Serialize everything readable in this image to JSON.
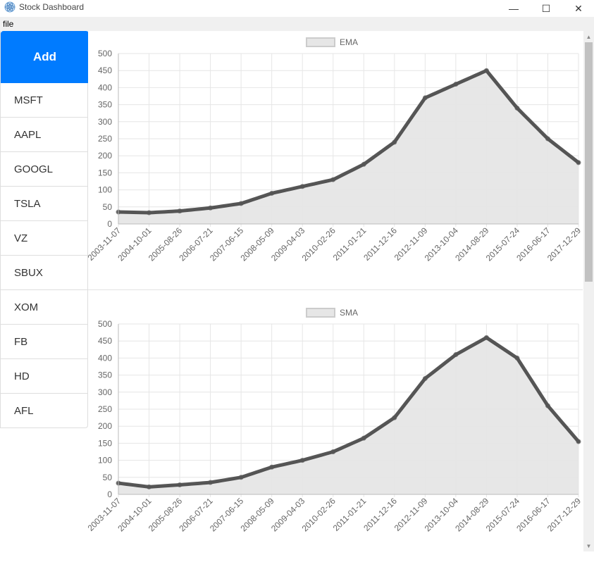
{
  "window": {
    "title": "Stock Dashboard",
    "minimize_glyph": "—",
    "maximize_glyph": "☐",
    "close_glyph": "✕"
  },
  "menu": {
    "file_label": "file"
  },
  "sidebar": {
    "add_label": "Add",
    "add_color": "#007bff",
    "tickers": [
      "MSFT",
      "AAPL",
      "GOOGL",
      "TSLA",
      "VZ",
      "SBUX",
      "XOM",
      "FB",
      "HD",
      "AFL"
    ]
  },
  "scrollbar": {
    "up_glyph": "▲",
    "down_glyph": "▼"
  },
  "chart_data": [
    {
      "type": "area",
      "legend": "EMA",
      "legend_position": "top",
      "grid": true,
      "ylim": [
        0,
        500
      ],
      "yticks": [
        0,
        50,
        100,
        150,
        200,
        250,
        300,
        350,
        400,
        450,
        500
      ],
      "x_tick_labels": [
        "2003-11-07",
        "2004-10-01",
        "2005-08-26",
        "2006-07-21",
        "2007-06-15",
        "2008-05-09",
        "2009-04-03",
        "2010-02-26",
        "2011-01-21",
        "2011-12-16",
        "2012-11-09",
        "2013-10-04",
        "2014-08-29",
        "2015-07-24",
        "2016-06-17",
        "2017-12-29"
      ],
      "x": [
        "2003-11-07",
        "2004-10-01",
        "2005-08-26",
        "2006-07-21",
        "2007-06-15",
        "2008-05-09",
        "2009-04-03",
        "2010-02-26",
        "2011-01-21",
        "2011-12-16",
        "2012-11-09",
        "2013-10-04",
        "2014-08-29",
        "2015-07-24",
        "2016-06-17",
        "2017-12-29"
      ],
      "values": [
        35,
        33,
        38,
        47,
        60,
        90,
        110,
        130,
        175,
        240,
        370,
        410,
        450,
        340,
        250,
        180
      ],
      "line_color": "#444444",
      "fill_color": "#e6e6e6"
    },
    {
      "type": "area",
      "legend": "SMA",
      "legend_position": "top",
      "grid": true,
      "ylim": [
        0,
        500
      ],
      "yticks": [
        0,
        50,
        100,
        150,
        200,
        250,
        300,
        350,
        400,
        450,
        500
      ],
      "x_tick_labels": [
        "2003-11-07",
        "2004-10-01",
        "2005-08-26",
        "2006-07-21",
        "2007-06-15",
        "2008-05-09",
        "2009-04-03",
        "2010-02-26",
        "2011-01-21",
        "2011-12-16",
        "2012-11-09",
        "2013-10-04",
        "2014-08-29",
        "2015-07-24",
        "2016-06-17",
        "2017-12-29"
      ],
      "x": [
        "2003-11-07",
        "2004-10-01",
        "2005-08-26",
        "2006-07-21",
        "2007-06-15",
        "2008-05-09",
        "2009-04-03",
        "2010-02-26",
        "2011-01-21",
        "2011-12-16",
        "2012-11-09",
        "2013-10-04",
        "2014-08-29",
        "2015-07-24",
        "2016-06-17",
        "2017-12-29"
      ],
      "values": [
        33,
        22,
        28,
        35,
        50,
        80,
        100,
        125,
        165,
        225,
        340,
        410,
        460,
        400,
        260,
        155
      ],
      "line_color": "#444444",
      "fill_color": "#e6e6e6"
    }
  ]
}
